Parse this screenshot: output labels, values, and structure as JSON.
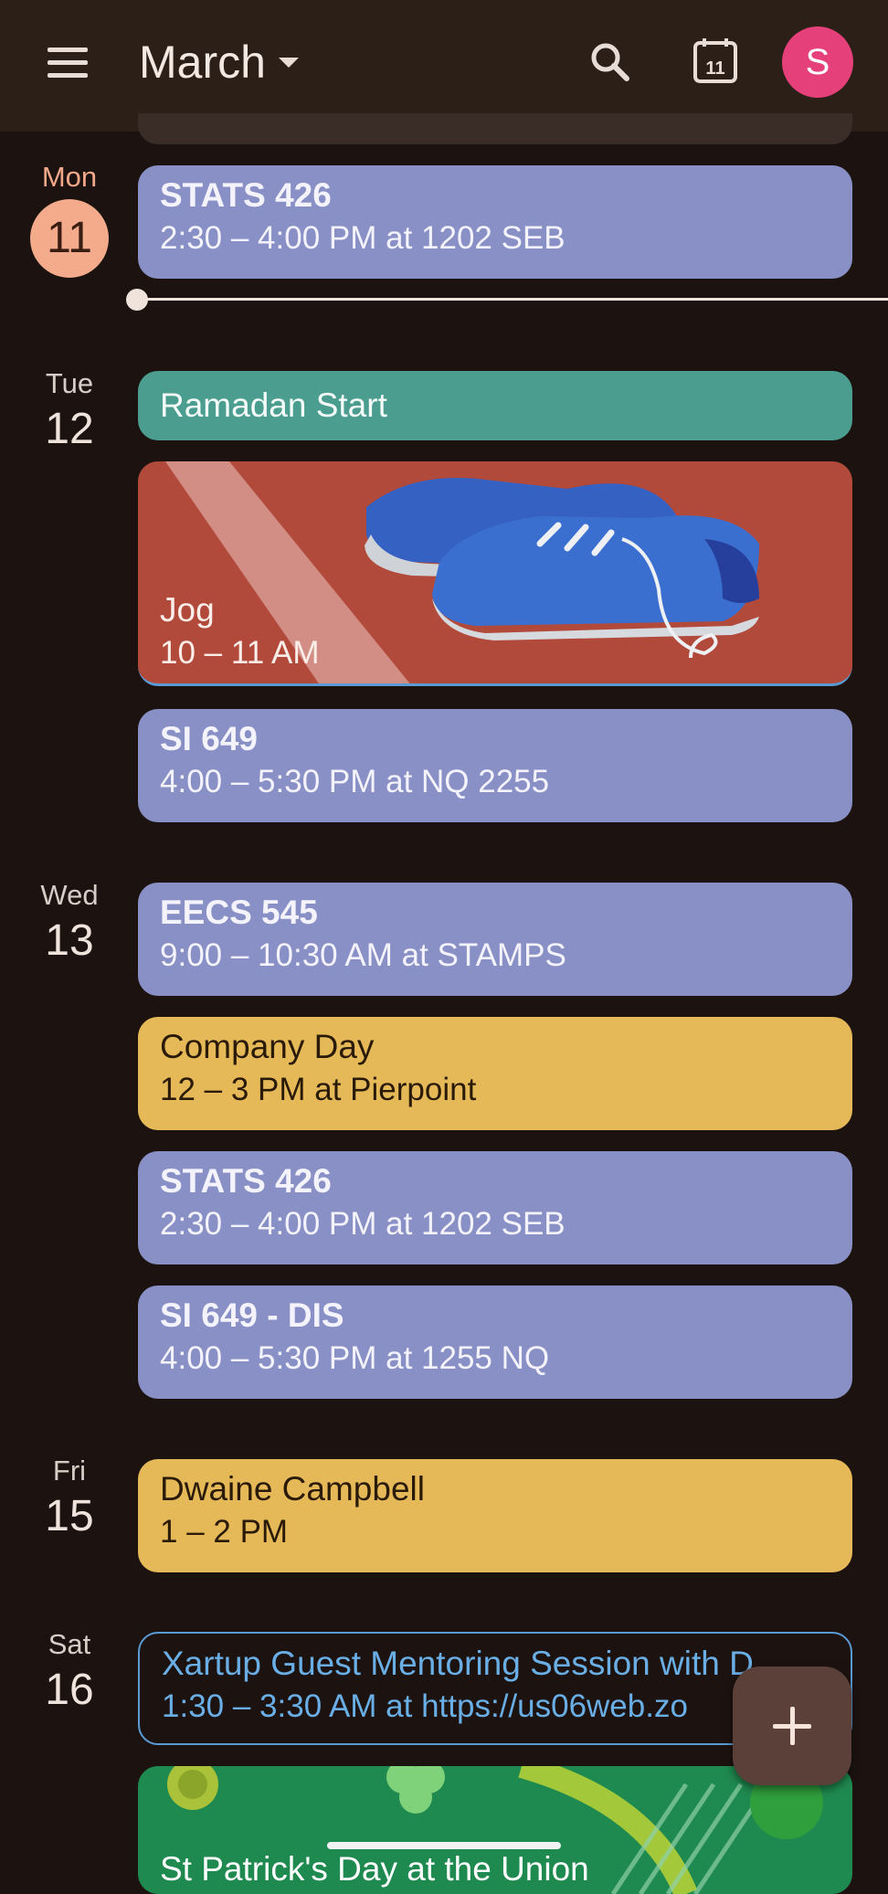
{
  "header": {
    "month": "March",
    "today_icon_day": "11",
    "avatar_initial": "S",
    "icons": [
      "menu-icon",
      "chevron-down-icon",
      "search-icon",
      "calendar-today-icon"
    ]
  },
  "days": [
    {
      "name": "Mon",
      "num": "11",
      "today": true
    },
    {
      "name": "Tue",
      "num": "12"
    },
    {
      "name": "Wed",
      "num": "13"
    },
    {
      "name": "Fri",
      "num": "15"
    },
    {
      "name": "Sat",
      "num": "16"
    }
  ],
  "events": {
    "mon_stats": {
      "title": "STATS 426",
      "time": "2:30 – 4:00 PM at 1202 SEB"
    },
    "tue_ramadan": {
      "title": "Ramadan Start"
    },
    "tue_jog": {
      "title": "Jog",
      "time": "10 – 11 AM"
    },
    "tue_si649": {
      "title": "SI 649",
      "time": "4:00 – 5:30 PM at NQ 2255"
    },
    "wed_eecs": {
      "title": "EECS 545",
      "time": "9:00 – 10:30 AM at STAMPS"
    },
    "wed_company": {
      "title": "Company Day",
      "time": "12 – 3 PM at Pierpoint"
    },
    "wed_stats": {
      "title": "STATS 426",
      "time": "2:30 – 4:00 PM at 1202 SEB"
    },
    "wed_si649dis": {
      "title": "SI 649 - DIS",
      "time": "4:00 – 5:30 PM at 1255 NQ"
    },
    "fri_dwaine": {
      "title": "Dwaine Campbell",
      "time": "1 – 2 PM"
    },
    "sat_xartup": {
      "title": "Xartup Guest Mentoring Session with D",
      "time": "1:30 – 3:30 AM at https://us06web.zo"
    },
    "sat_stpat": {
      "title": "St Patrick's Day at the Union"
    }
  },
  "colors": {
    "class": "#8890c6",
    "holiday": "#4a9d8f",
    "personal": "#e6b958",
    "outline": "#5b9bd5",
    "avatar": "#e6407a",
    "today": "#f4ab8c"
  },
  "fab_icon": "plus-icon"
}
